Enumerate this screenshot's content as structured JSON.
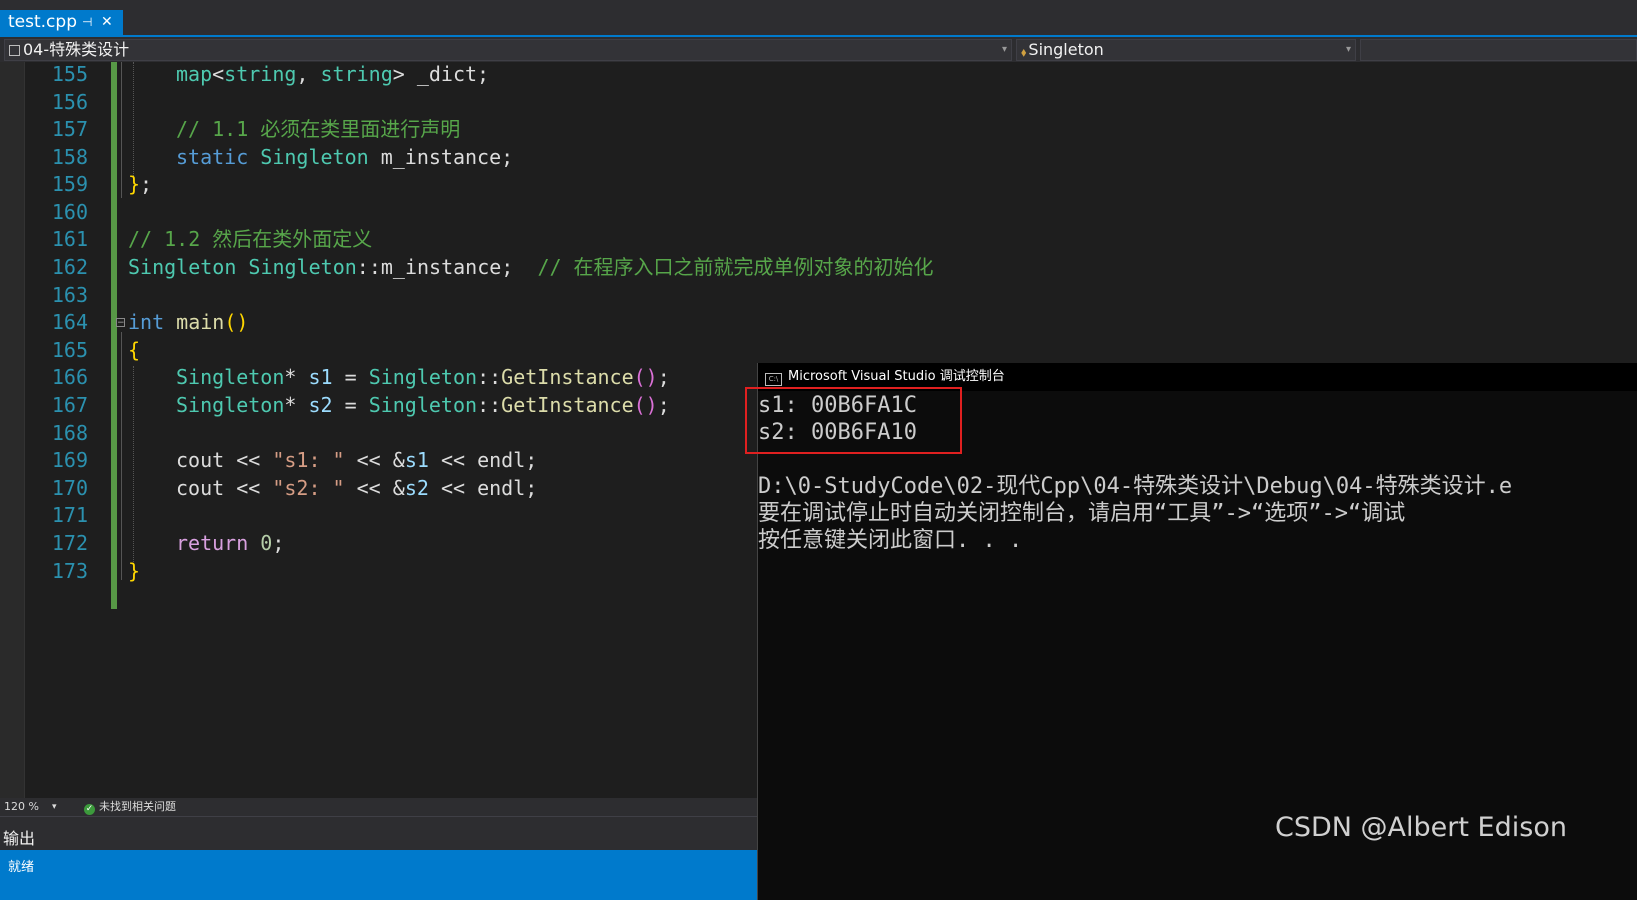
{
  "tab": {
    "name": "test.cpp",
    "pin": "⊣",
    "close": "✕"
  },
  "nav": {
    "project": "04-特殊类设计",
    "scope": "Singleton"
  },
  "code_lines": [
    {
      "n": "155"
    },
    {
      "n": "156"
    },
    {
      "n": "157"
    },
    {
      "n": "158"
    },
    {
      "n": "159"
    },
    {
      "n": "160"
    },
    {
      "n": "161"
    },
    {
      "n": "162"
    },
    {
      "n": "163"
    },
    {
      "n": "164"
    },
    {
      "n": "165"
    },
    {
      "n": "166"
    },
    {
      "n": "167"
    },
    {
      "n": "168"
    },
    {
      "n": "169"
    },
    {
      "n": "170"
    },
    {
      "n": "171"
    },
    {
      "n": "172"
    },
    {
      "n": "173"
    }
  ],
  "code": {
    "l155": {
      "a": "map",
      "b": "<",
      "c": "string",
      "d": ", ",
      "e": "string",
      "f": "> _dict;"
    },
    "l157": "// 1.1 必须在类里面进行声明",
    "l158": {
      "a": "static",
      "b": "Singleton",
      "c": " m_instance;"
    },
    "l159": {
      "a": "}",
      "b": ";"
    },
    "l161": "// 1.2 然后在类外面定义",
    "l162": {
      "a": "Singleton",
      "b": "Singleton",
      "c": "::m_instance;",
      "d": "// 在程序入口之前就完成单例对象的初始化"
    },
    "l164": {
      "a": "int",
      "b": "main",
      "c": "()"
    },
    "l165": "{",
    "l166": {
      "a": "Singleton",
      "b": "* ",
      "c": "s1",
      "d": " = ",
      "e": "Singleton",
      "f": "::",
      "g": "GetInstance",
      "h": "()",
      "i": ";"
    },
    "l167": {
      "a": "Singleton",
      "b": "* ",
      "c": "s2",
      "d": " = ",
      "e": "Singleton",
      "f": "::",
      "g": "GetInstance",
      "h": "()",
      "i": ";"
    },
    "l169": {
      "a": "cout",
      "b": " << ",
      "c": "\"s1: \"",
      "d": " << &",
      "e": "s1",
      "f": " << ",
      "g": "endl",
      "h": ";"
    },
    "l170": {
      "a": "cout",
      "b": " << ",
      "c": "\"s2: \"",
      "d": " << &",
      "e": "s2",
      "f": " << ",
      "g": "endl",
      "h": ";"
    },
    "l172": {
      "a": "return",
      "b": " ",
      "c": "0",
      "d": ";"
    },
    "l173": "}"
  },
  "editor_status": {
    "zoom": "120 %",
    "issues": "未找到相关问题"
  },
  "output_label": "输出",
  "status_text": "就绪",
  "console": {
    "title": "Microsoft Visual Studio 调试控制台",
    "lines": [
      "s1: 00B6FA1C",
      "s2: 00B6FA10",
      "",
      "D:\\0-StudyCode\\02-现代Cpp\\04-特殊类设计\\Debug\\04-特殊类设计.e",
      "要在调试停止时自动关闭控制台，请启用“工具”->“选项”->“调试",
      "按任意键关闭此窗口. . ."
    ]
  },
  "watermark": "CSDN @Albert Edison"
}
